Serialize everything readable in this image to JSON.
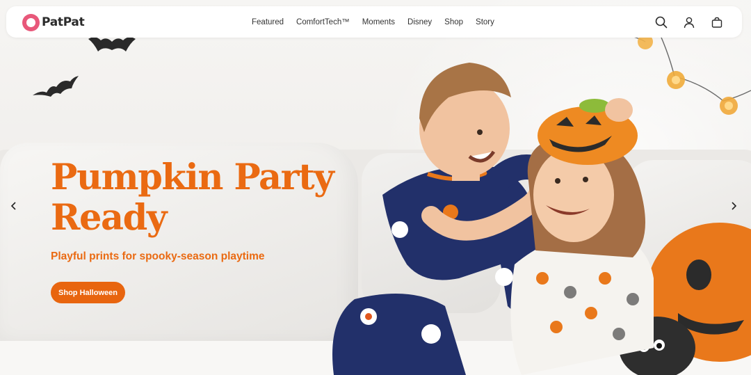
{
  "brand": {
    "name": "PatPat",
    "color": "#e8587a"
  },
  "nav": {
    "items": [
      "Featured",
      "ComfortTech™",
      "Moments",
      "Disney",
      "Shop",
      "Story"
    ],
    "icons": [
      "search-icon",
      "account-icon",
      "bag-icon"
    ]
  },
  "hero": {
    "headline_line1": "Pumpkin Party",
    "headline_line2": "Ready",
    "subheadline": "Playful prints for spooky-season playtime",
    "cta_label": "Shop Halloween",
    "accent_color": "#ea6a12",
    "carousel_controls": [
      "chevron-left-icon",
      "chevron-right-icon"
    ]
  }
}
